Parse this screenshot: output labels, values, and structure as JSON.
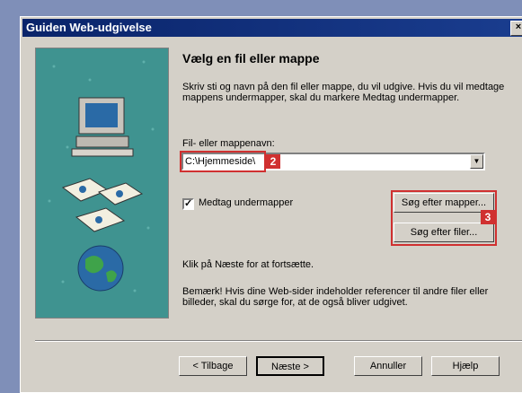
{
  "dialog": {
    "title": "Guiden Web-udgivelse",
    "close_label": "×"
  },
  "page": {
    "heading": "Vælg en fil eller mappe",
    "description": "Skriv sti og navn på den fil eller mappe, du vil udgive. Hvis du vil medtage mappens undermapper, skal du markere Medtag undermapper.",
    "field_label": "Fil- eller mappenavn:",
    "path_value": "C:\\Hjemmeside\\",
    "include_subfolders_label": "Medtag undermapper",
    "include_subfolders_checked": "✓",
    "browse_folders_label": "Søg efter mapper...",
    "browse_files_label": "Søg efter filer...",
    "hint": "Klik på Næste for at fortsætte.",
    "note": "Bemærk! Hvis dine Web-sider indeholder referencer til andre filer eller billeder, skal du sørge for, at de også bliver udgivet."
  },
  "annotations": {
    "badge_2": "2",
    "badge_3": "3"
  },
  "footer": {
    "back_label": "< Tilbage",
    "next_label": "Næste >",
    "cancel_label": "Annuller",
    "help_label": "Hjælp"
  },
  "colors": {
    "title_bar": "#0a246a",
    "highlight_red": "#d03030",
    "art_teal": "#3f9390"
  }
}
